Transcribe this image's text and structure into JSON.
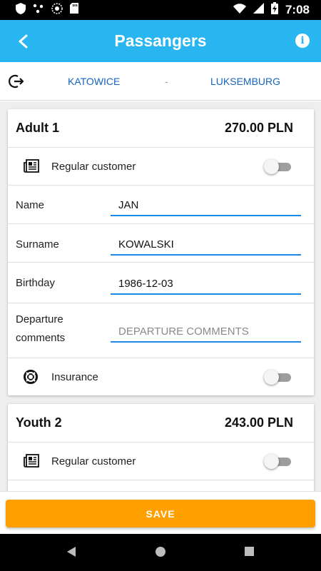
{
  "status_bar": {
    "time": "7:08",
    "left_icons": [
      "shield-icon",
      "dots-icon",
      "sync-icon",
      "sd-card-icon"
    ],
    "right_icons": [
      "wifi-icon",
      "signal-icon",
      "battery-charging-icon"
    ]
  },
  "app_bar": {
    "title": "Passangers",
    "back_icon": "arrow-left-icon",
    "info_icon": "info-icon",
    "info_glyph": "i",
    "color": "#29b6f0"
  },
  "route": {
    "from": "KATOWICE",
    "separator": "-",
    "to": "LUKSEMBURG",
    "icon": "exit-icon",
    "text_color": "#1565c0"
  },
  "passengers": [
    {
      "type": "Adult 1",
      "price": "270.00 PLN",
      "regular_customer": {
        "label": "Regular customer",
        "checked": false,
        "icon": "newspaper-icon"
      },
      "fields": {
        "name": {
          "label": "Name",
          "value": "JAN"
        },
        "surname": {
          "label": "Surname",
          "value": "KOWALSKI"
        },
        "birthday": {
          "label": "Birthday",
          "value": "1986-12-03"
        },
        "departure_comments": {
          "label_line1": "Departure",
          "label_line2": "comments",
          "value": "",
          "placeholder": "DEPARTURE COMMENTS"
        }
      },
      "insurance": {
        "label": "Insurance",
        "checked": false,
        "icon": "lifebuoy-icon"
      }
    },
    {
      "type": "Youth 2",
      "price": "243.00 PLN",
      "regular_customer": {
        "label": "Regular customer",
        "checked": false,
        "icon": "newspaper-icon"
      }
    }
  ],
  "save_button": {
    "label": "SAVE",
    "color": "#ffa000"
  },
  "nav_bar": {
    "buttons": [
      "back-triangle-icon",
      "home-circle-icon",
      "recents-square-icon"
    ]
  }
}
